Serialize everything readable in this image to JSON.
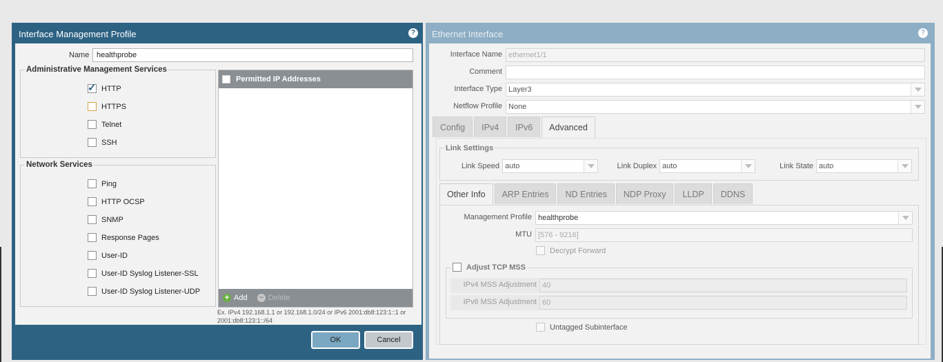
{
  "imp": {
    "title": "Interface Management Profile",
    "help": "?",
    "name_label": "Name",
    "name_value": "healthprobe",
    "admin_title": "Administrative Management Services",
    "admin_items": [
      {
        "label": "HTTP",
        "checked": true
      },
      {
        "label": "HTTPS",
        "checked": false
      },
      {
        "label": "Telnet",
        "checked": false
      },
      {
        "label": "SSH",
        "checked": false
      }
    ],
    "net_title": "Network Services",
    "net_items": [
      {
        "label": "Ping"
      },
      {
        "label": "HTTP OCSP"
      },
      {
        "label": "SNMP"
      },
      {
        "label": "Response Pages"
      },
      {
        "label": "User-ID"
      },
      {
        "label": "User-ID Syslog Listener-SSL"
      },
      {
        "label": "User-ID Syslog Listener-UDP"
      }
    ],
    "grid_header": "Permitted IP Addresses",
    "add_label": "Add",
    "delete_label": "Delete",
    "hint": "Ex. IPv4 192.168.1.1 or 192.168.1.0/24 or IPv6 2001:db8:123:1::1 or 2001:db8:123:1::/64",
    "ok_label": "OK",
    "cancel_label": "Cancel"
  },
  "eth": {
    "title": "Ethernet Interface",
    "help": "?",
    "iface_name_label": "Interface Name",
    "iface_name_value": "ethernet1/1",
    "comment_label": "Comment",
    "comment_value": "",
    "iface_type_label": "Interface Type",
    "iface_type_value": "Layer3",
    "netflow_label": "Netflow Profile",
    "netflow_value": "None",
    "tabs": [
      "Config",
      "IPv4",
      "IPv6",
      "Advanced"
    ],
    "link_settings_title": "Link Settings",
    "link_speed_label": "Link Speed",
    "link_speed_value": "auto",
    "link_duplex_label": "Link Duplex",
    "link_duplex_value": "auto",
    "link_state_label": "Link State",
    "link_state_value": "auto",
    "subtabs": [
      "Other Info",
      "ARP Entries",
      "ND Entries",
      "NDP Proxy",
      "LLDP",
      "DDNS"
    ],
    "mgmt_profile_label": "Management Profile",
    "mgmt_profile_value": "healthprobe",
    "mtu_label": "MTU",
    "mtu_placeholder": "[576 - 9216]",
    "decrypt_forward_label": "Decrypt Forward",
    "adjust_tcp_label": "Adjust TCP MSS",
    "ipv4_mss_label": "IPv4 MSS Adjustment",
    "ipv4_mss_value": "40",
    "ipv6_mss_label": "IPv6 MSS Adjustment",
    "ipv6_mss_value": "60",
    "untagged_label": "Untagged Subinterface"
  }
}
